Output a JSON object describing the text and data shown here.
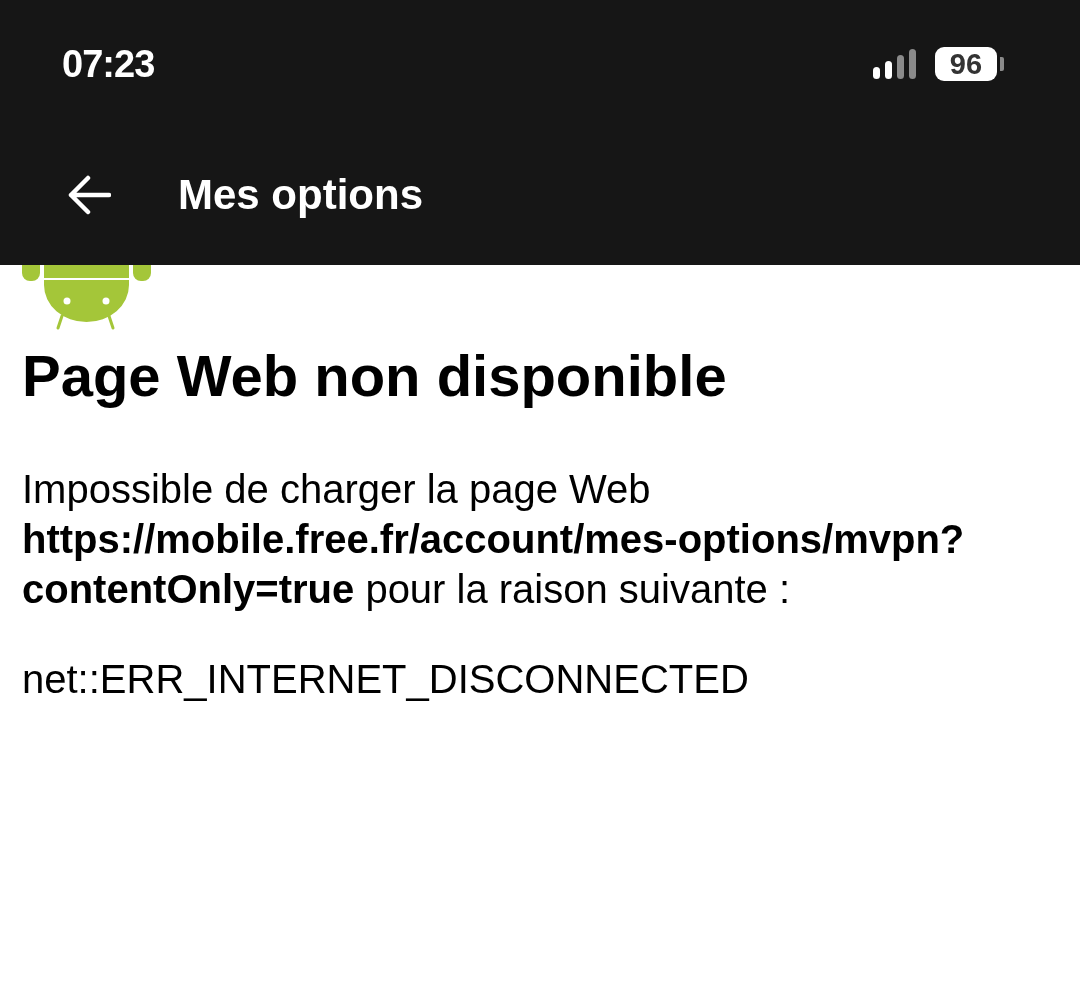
{
  "status_bar": {
    "time": "07:23",
    "battery": "96"
  },
  "app_bar": {
    "title": "Mes options"
  },
  "error_page": {
    "title": "Page Web non disponible",
    "message": "Impossible de charger la page Web **https://mobile.free.fr/account/mes-options/mvpn?contentOnly=true** pour la raison suivante :",
    "error_code": "net::ERR_INTERNET_DISCONNECTED"
  }
}
